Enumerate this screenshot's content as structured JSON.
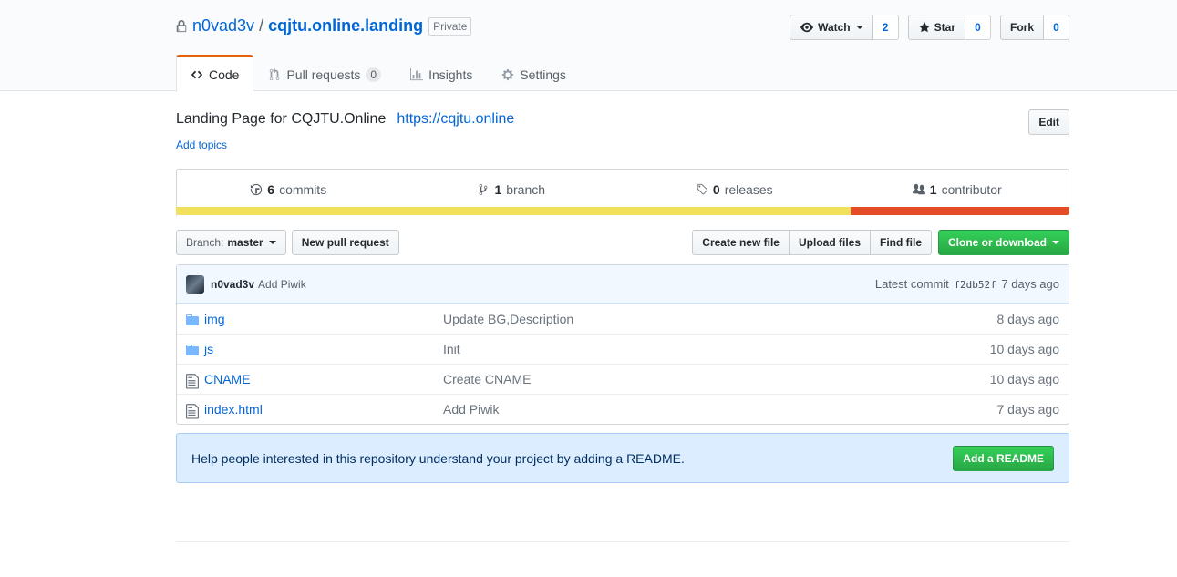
{
  "repo": {
    "owner": "n0vad3v",
    "separator": "/",
    "name": "cqjtu.online.landing",
    "visibility": "Private"
  },
  "actions": {
    "watch_label": "Watch",
    "watch_count": "2",
    "star_label": "Star",
    "star_count": "0",
    "fork_label": "Fork",
    "fork_count": "0"
  },
  "tabs": [
    {
      "label": "Code",
      "icon": "code-icon",
      "selected": true
    },
    {
      "label": "Pull requests",
      "icon": "pull-request-icon",
      "counter": "0"
    },
    {
      "label": "Insights",
      "icon": "graph-icon"
    },
    {
      "label": "Settings",
      "icon": "gear-icon"
    }
  ],
  "about": {
    "description": "Landing Page for CQJTU.Online",
    "homepage": "https://cqjtu.online",
    "add_topics": "Add topics",
    "edit_label": "Edit"
  },
  "summary": {
    "commits_count": "6",
    "commits_label": "commits",
    "branch_count": "1",
    "branch_label": "branch",
    "releases_count": "0",
    "releases_label": "releases",
    "contributor_count": "1",
    "contributor_label": "contributor"
  },
  "languages": [
    {
      "color": "#f1e05a",
      "percent": 75.5
    },
    {
      "color": "#e34c26",
      "percent": 24.5
    }
  ],
  "file_nav": {
    "branch_prefix": "Branch:",
    "branch_name": "master",
    "new_pr": "New pull request",
    "create_file": "Create new file",
    "upload_files": "Upload files",
    "find_file": "Find file",
    "clone": "Clone or download"
  },
  "latest_commit": {
    "author": "n0vad3v",
    "message": "Add Piwik",
    "prefix": "Latest commit",
    "sha": "f2db52f",
    "age": "7 days ago"
  },
  "files": [
    {
      "type": "dir",
      "name": "img",
      "message": "Update BG,Description",
      "age": "8 days ago"
    },
    {
      "type": "dir",
      "name": "js",
      "message": "Init",
      "age": "10 days ago"
    },
    {
      "type": "file",
      "name": "CNAME",
      "message": "Create CNAME",
      "age": "10 days ago"
    },
    {
      "type": "file",
      "name": "index.html",
      "message": "Add Piwik",
      "age": "7 days ago"
    }
  ],
  "readme_hint": {
    "text": "Help people interested in this repository understand your project by adding a README.",
    "button": "Add a README"
  }
}
